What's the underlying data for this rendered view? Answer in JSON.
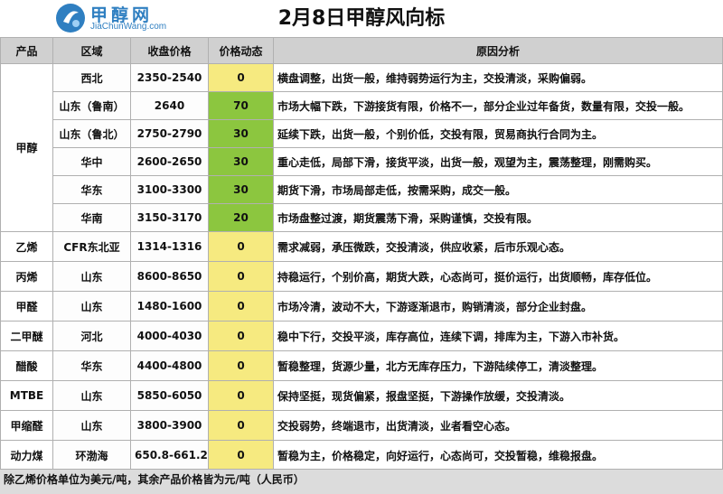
{
  "logo": {
    "chinese": "甲醇网",
    "english": "JiaChunWang.com"
  },
  "title": "2月8日甲醇风向标",
  "columns": [
    "产品",
    "区域",
    "收盘价格",
    "价格动态",
    "原因分析"
  ],
  "rows": [
    {
      "product": "甲醇",
      "region": "西北",
      "price": "2350-2540",
      "change": "0",
      "analysis": "横盘调整，出货一般，维持弱势运行为主，交投清淡，采购偏弱。"
    },
    {
      "product": "",
      "region": "山东（鲁南）",
      "price": "2640",
      "change": "70",
      "analysis": "市场大幅下跌，下游接货有限，价格不一，部分企业过年备货，数量有限，交投一般。"
    },
    {
      "product": "",
      "region": "山东（鲁北）",
      "price": "2750-2790",
      "change": "30",
      "analysis": "延续下跌，出货一般，个别价低，交投有限，贸易商执行合同为主。"
    },
    {
      "product": "",
      "region": "华中",
      "price": "2600-2650",
      "change": "30",
      "analysis": "重心走低，局部下滑，接货平淡，出货一般，观望为主，震荡整理，刚需购买。"
    },
    {
      "product": "",
      "region": "华东",
      "price": "3100-3300",
      "change": "30",
      "analysis": "期货下滑，市场局部走低，按需采购，成交一般。"
    },
    {
      "product": "",
      "region": "华南",
      "price": "3150-3170",
      "change": "20",
      "analysis": "市场盘整过渡，期货震荡下滑，采购谨慎，交投有限。"
    },
    {
      "product": "乙烯",
      "region": "CFR东北亚",
      "price": "1314-1316",
      "change": "0",
      "analysis": "需求减弱，承压微跌，交投清淡，供应收紧，后市乐观心态。"
    },
    {
      "product": "丙烯",
      "region": "山东",
      "price": "8600-8650",
      "change": "0",
      "analysis": "持稳运行，个别价高，期货大跌，心态尚可，挺价运行，出货顺畅，库存低位。"
    },
    {
      "product": "甲醛",
      "region": "山东",
      "price": "1480-1600",
      "change": "0",
      "analysis": "市场冷清，波动不大，下游逐渐退市，购销清淡，部分企业封盘。"
    },
    {
      "product": "二甲醚",
      "region": "河北",
      "price": "4000-4030",
      "change": "0",
      "analysis": "稳中下行，交投平淡，库存高位，连续下调，排库为主，下游入市补货。"
    },
    {
      "product": "醋酸",
      "region": "华东",
      "price": "4400-4800",
      "change": "0",
      "analysis": "暂稳整理，货源少量，北方无库存压力，下游陆续停工，清淡整理。"
    },
    {
      "product": "MTBE",
      "region": "山东",
      "price": "5850-6050",
      "change": "0",
      "analysis": "保持坚挺，现货偏紧，报盘坚挺，下游操作放缓，交投清淡。"
    },
    {
      "product": "甲缩醛",
      "region": "山东",
      "price": "3800-3900",
      "change": "0",
      "analysis": "交投弱势，终端退市，出货清淡，业者看空心态。"
    },
    {
      "product": "动力煤",
      "region": "环渤海",
      "price": "650.8-661.2",
      "change": "0",
      "analysis": "暂稳为主，价格稳定，向好运行，心态尚可，交投暂稳，维稳报盘。"
    }
  ],
  "footer_note": "除乙烯价格单位为美元/吨，其余产品价格皆为元/吨（人民币）",
  "colors": {
    "header_bg": "#d0d0d0",
    "change_zero_bg": "#f6ea80",
    "change_up_bg": "#8cc63f",
    "logo_blue": "#2f7fc1"
  }
}
